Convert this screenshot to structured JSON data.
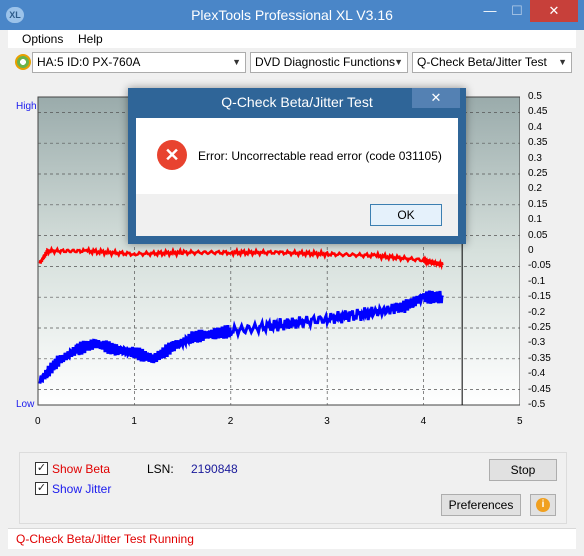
{
  "app": {
    "title": "PlexTools Professional XL V3.16",
    "icon_text": "XL"
  },
  "titlebar": {
    "minimize": "—",
    "maximize": "☐",
    "close": "✕"
  },
  "menu": {
    "options": "Options",
    "help": "Help"
  },
  "toolbar": {
    "drive": "HA:5 ID:0  PX-760A",
    "function": "DVD Diagnostic Functions",
    "test": "Q-Check Beta/Jitter Test"
  },
  "chart_data": {
    "type": "line",
    "y_top_label": "High",
    "y_bottom_label": "Low",
    "x_ticks": [
      "0",
      "1",
      "2",
      "3",
      "4",
      "5"
    ],
    "y_right_ticks": [
      "0.5",
      "0.45",
      "0.4",
      "0.35",
      "0.3",
      "0.25",
      "0.2",
      "0.15",
      "0.1",
      "0.05",
      "0",
      "-0.05",
      "-0.1",
      "-0.15",
      "-0.2",
      "-0.25",
      "-0.3",
      "-0.35",
      "-0.4",
      "-0.45",
      "-0.5"
    ],
    "xlim": [
      0,
      5
    ],
    "ylim": [
      -0.5,
      0.5
    ],
    "marker_x": 4.4,
    "series": [
      {
        "color": "#ff0000",
        "x": [
          0.02,
          0.1,
          0.5,
          1.0,
          1.5,
          2.0,
          2.5,
          3.0,
          3.5,
          4.0,
          4.2
        ],
        "y": [
          -0.04,
          0.0,
          0.0,
          -0.01,
          -0.005,
          -0.005,
          -0.005,
          -0.01,
          -0.015,
          -0.03,
          -0.045
        ]
      },
      {
        "color": "#0000ff",
        "x": [
          0.02,
          0.2,
          0.4,
          0.6,
          0.8,
          1.0,
          1.2,
          1.4,
          1.6,
          1.8,
          2.0,
          2.5,
          3.0,
          3.5,
          3.8,
          4.0,
          4.2
        ],
        "y": [
          -0.42,
          -0.36,
          -0.32,
          -0.3,
          -0.32,
          -0.33,
          -0.35,
          -0.31,
          -0.28,
          -0.27,
          -0.26,
          -0.24,
          -0.22,
          -0.2,
          -0.18,
          -0.15,
          -0.15
        ]
      }
    ]
  },
  "dialog": {
    "title": "Q-Check Beta/Jitter Test",
    "close": "✕",
    "message": "Error: Uncorrectable read error (code 031105)",
    "ok": "OK"
  },
  "controls": {
    "show_beta": "Show Beta",
    "show_jitter": "Show Jitter",
    "beta_checked": true,
    "jitter_checked": true,
    "lsn_label": "LSN:",
    "lsn_value": "2190848",
    "stop": "Stop",
    "preferences": "Preferences",
    "info_icon": "i"
  },
  "status": {
    "text": "Q-Check Beta/Jitter Test Running"
  }
}
